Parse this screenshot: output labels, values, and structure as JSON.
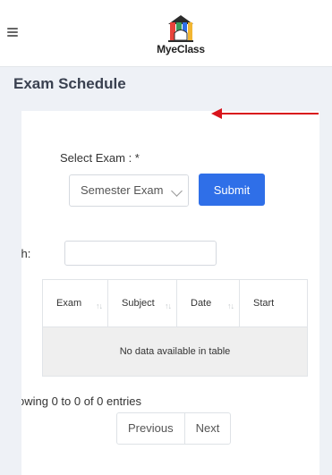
{
  "header": {
    "menu_icon": "hamburger-icon",
    "logo_text": "MyeClass"
  },
  "page": {
    "title": "Exam Schedule"
  },
  "form": {
    "select_label": "Select Exam : *",
    "exam_select_value": "Semester Exam",
    "submit_label": "Submit"
  },
  "search": {
    "label": "ch:",
    "value": ""
  },
  "table": {
    "columns": [
      "Exam",
      "Subject",
      "Date",
      "Start"
    ],
    "empty_message": "No data available in table",
    "info": "owing 0 to 0 of 0 entries"
  },
  "pagination": {
    "previous": "Previous",
    "next": "Next"
  },
  "colors": {
    "accent": "#2f6fe8",
    "annotation_arrow": "#d9141c"
  }
}
